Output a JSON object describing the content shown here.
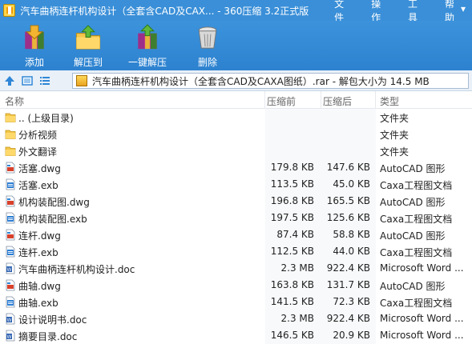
{
  "window": {
    "title": "汽车曲柄连杆机构设计（全套含CAD及CAX... - 360压缩 3.2正式版",
    "menu": [
      "文件",
      "操作",
      "工具",
      "帮助"
    ]
  },
  "toolbar": {
    "items": [
      {
        "label": "添加",
        "icon": "add-archive-icon"
      },
      {
        "label": "解压到",
        "icon": "extract-to-icon"
      },
      {
        "label": "一键解压",
        "icon": "one-click-extract-icon"
      },
      {
        "label": "删除",
        "icon": "trash-icon"
      }
    ]
  },
  "address": {
    "path": "汽车曲柄连杆机构设计（全套含CAD及CAXA图纸）.rar - 解包大小为 14.5 MB"
  },
  "columns": {
    "name": "名称",
    "size": "压缩前",
    "compressed": "压缩后",
    "type": "类型"
  },
  "files": [
    {
      "name": ".. (上级目录)",
      "size": "",
      "compressed": "",
      "type": "文件夹",
      "icon": "folder-icon"
    },
    {
      "name": "分析视频",
      "size": "",
      "compressed": "",
      "type": "文件夹",
      "icon": "folder-icon"
    },
    {
      "name": "外文翻译",
      "size": "",
      "compressed": "",
      "type": "文件夹",
      "icon": "folder-icon"
    },
    {
      "name": "活塞.dwg",
      "size": "179.8 KB",
      "compressed": "147.6 KB",
      "type": "AutoCAD 图形",
      "icon": "dwg-file-icon"
    },
    {
      "name": "活塞.exb",
      "size": "113.5 KB",
      "compressed": "45.0 KB",
      "type": "Caxa工程图文档",
      "icon": "exb-file-icon"
    },
    {
      "name": "机构装配图.dwg",
      "size": "196.8 KB",
      "compressed": "165.5 KB",
      "type": "AutoCAD 图形",
      "icon": "dwg-file-icon"
    },
    {
      "name": "机构装配图.exb",
      "size": "197.5 KB",
      "compressed": "125.6 KB",
      "type": "Caxa工程图文档",
      "icon": "exb-file-icon"
    },
    {
      "name": "连杆.dwg",
      "size": "87.4 KB",
      "compressed": "58.8 KB",
      "type": "AutoCAD 图形",
      "icon": "dwg-file-icon"
    },
    {
      "name": "连杆.exb",
      "size": "112.5 KB",
      "compressed": "44.0 KB",
      "type": "Caxa工程图文档",
      "icon": "exb-file-icon"
    },
    {
      "name": "汽车曲柄连杆机构设计.doc",
      "size": "2.3 MB",
      "compressed": "922.4 KB",
      "type": "Microsoft Word ...",
      "icon": "word-file-icon"
    },
    {
      "name": "曲轴.dwg",
      "size": "163.8 KB",
      "compressed": "131.7 KB",
      "type": "AutoCAD 图形",
      "icon": "dwg-file-icon"
    },
    {
      "name": "曲轴.exb",
      "size": "141.5 KB",
      "compressed": "72.3 KB",
      "type": "Caxa工程图文档",
      "icon": "exb-file-icon"
    },
    {
      "name": "设计说明书.doc",
      "size": "2.3 MB",
      "compressed": "922.4 KB",
      "type": "Microsoft Word ...",
      "icon": "word-file-icon"
    },
    {
      "name": "摘要目录.doc",
      "size": "146.5 KB",
      "compressed": "20.9 KB",
      "type": "Microsoft Word ...",
      "icon": "word-file-icon"
    }
  ]
}
